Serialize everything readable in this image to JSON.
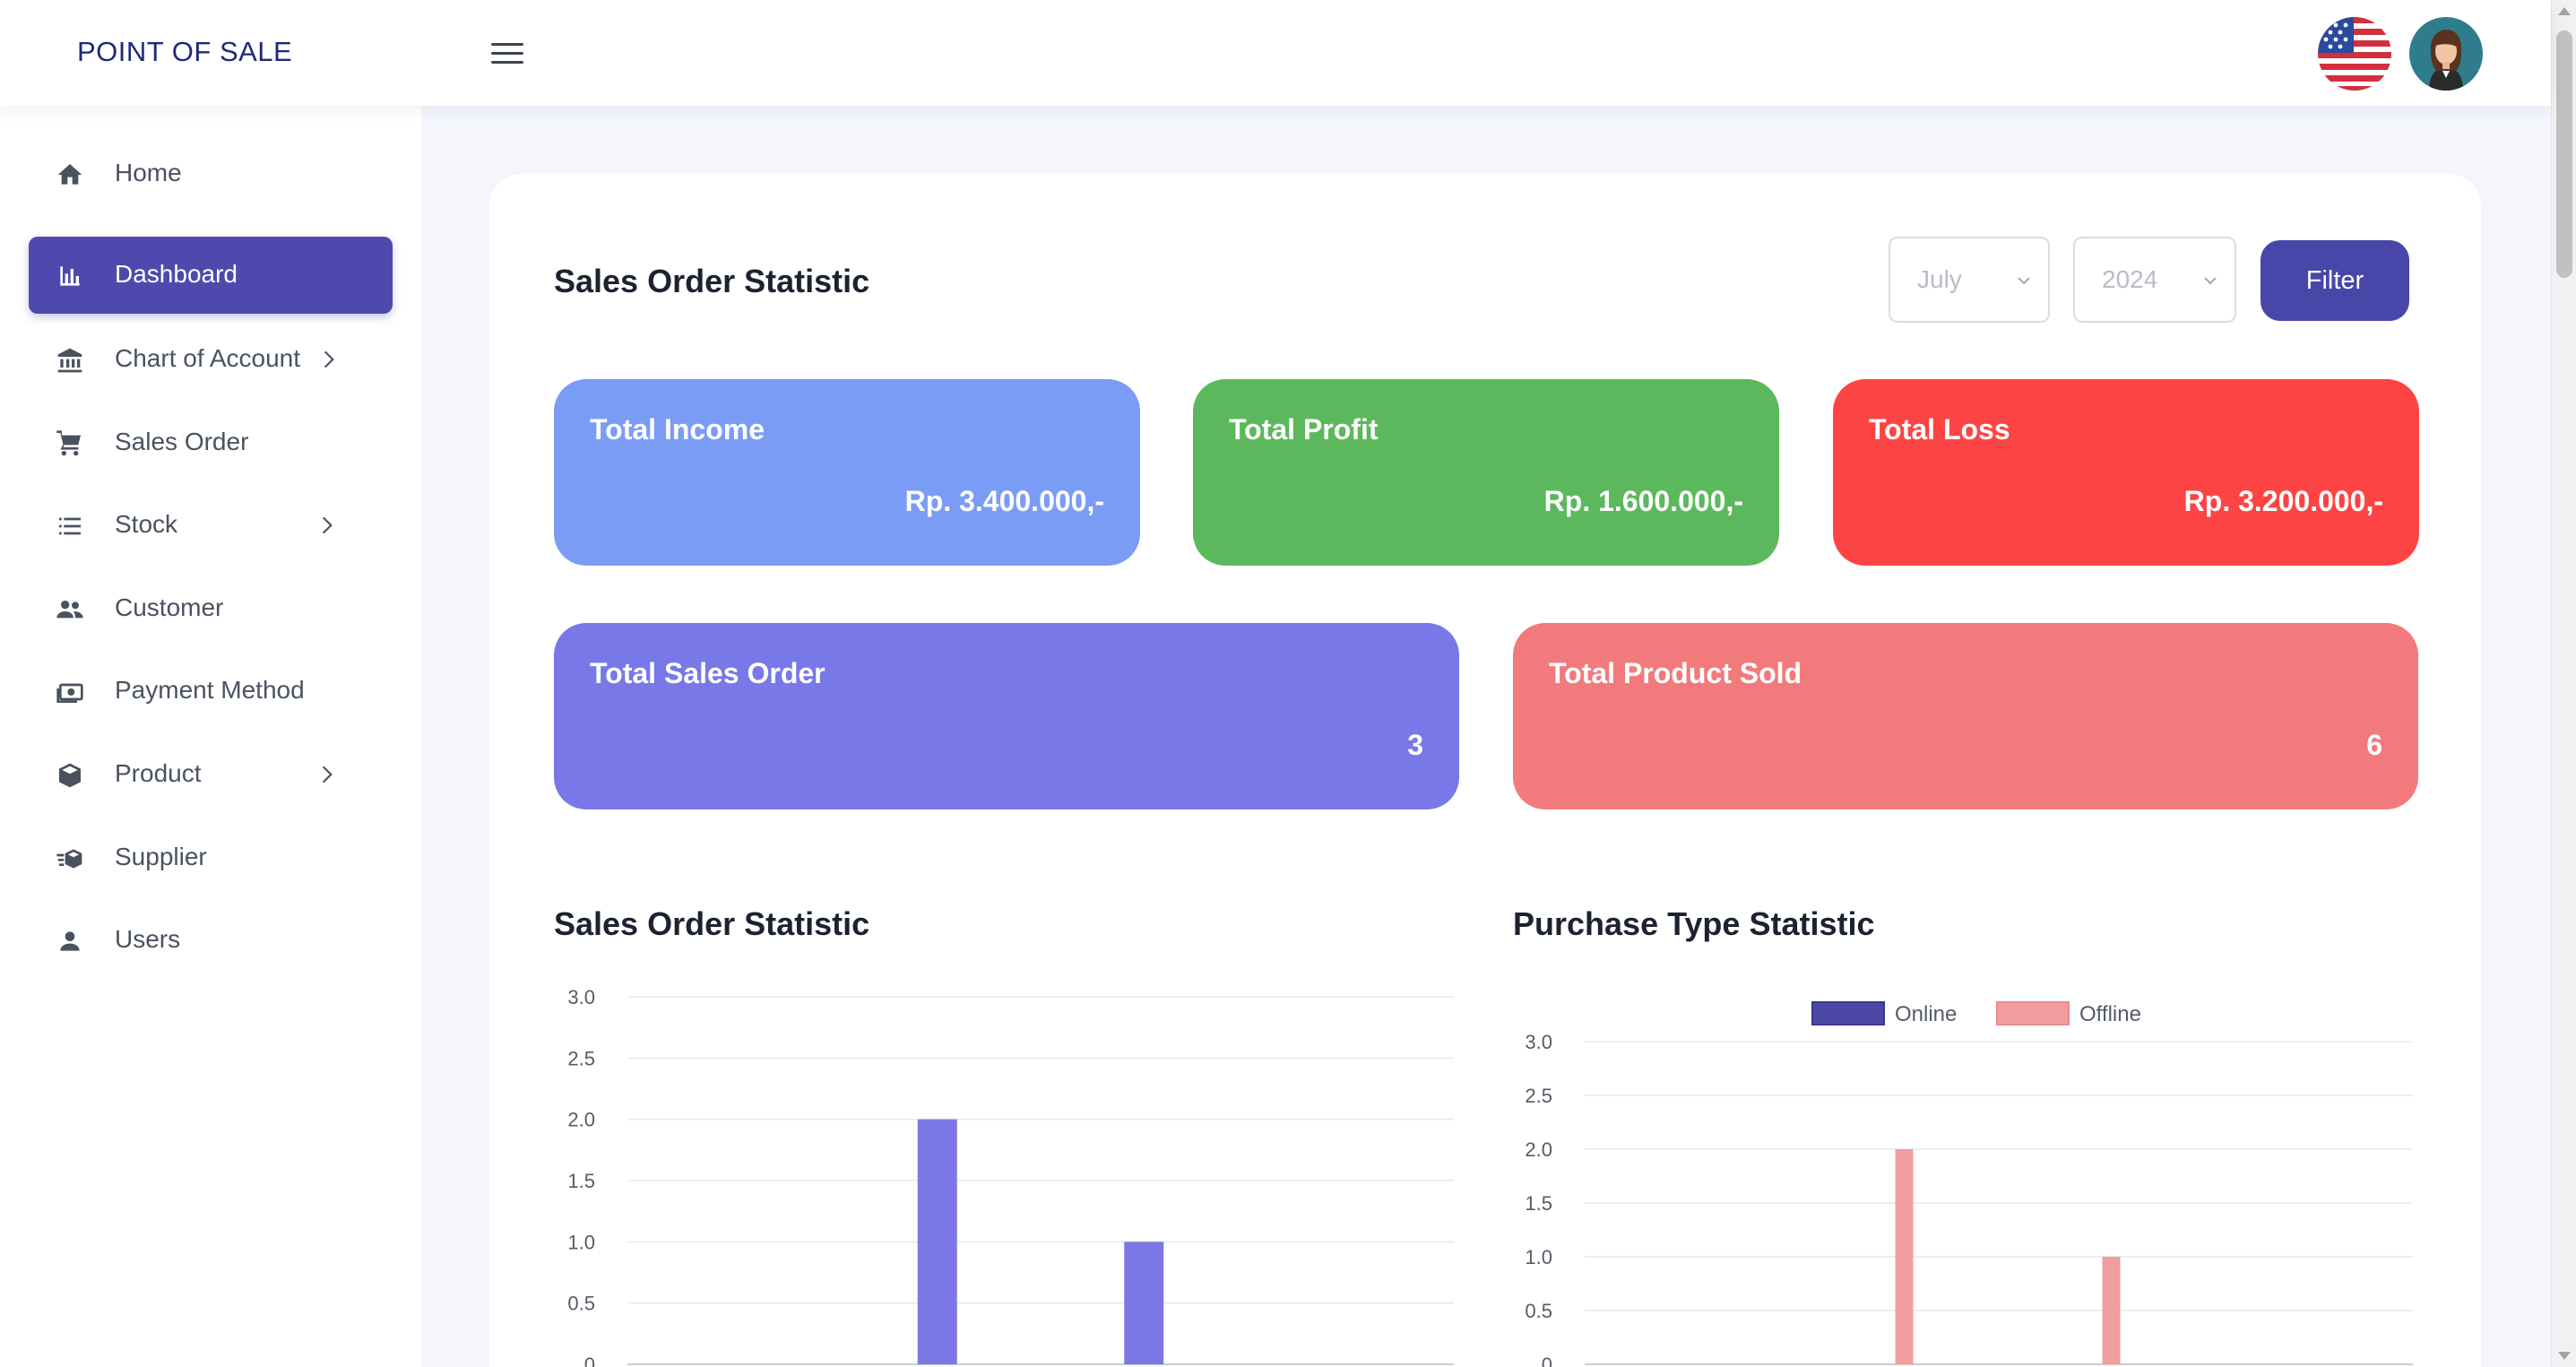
{
  "header": {
    "brand": "POINT OF SALE",
    "menu_icon": "hamburger-menu-icon",
    "language_icon": "us-flag-icon",
    "avatar_icon": "user-avatar-icon"
  },
  "sidebar": {
    "items": [
      {
        "label": "Home",
        "icon": "home-icon",
        "has_submenu": false,
        "active": false
      },
      {
        "label": "Dashboard",
        "icon": "bar-chart-icon",
        "has_submenu": false,
        "active": true
      },
      {
        "label": "Chart of Account",
        "icon": "bank-icon",
        "has_submenu": true,
        "active": false
      },
      {
        "label": "Sales Order",
        "icon": "cart-icon",
        "has_submenu": false,
        "active": false
      },
      {
        "label": "Stock",
        "icon": "list-icon",
        "has_submenu": true,
        "active": false
      },
      {
        "label": "Customer",
        "icon": "people-icon",
        "has_submenu": false,
        "active": false
      },
      {
        "label": "Payment Method",
        "icon": "payment-icon",
        "has_submenu": false,
        "active": false
      },
      {
        "label": "Product",
        "icon": "box-icon",
        "has_submenu": true,
        "active": false
      },
      {
        "label": "Supplier",
        "icon": "supplier-icon",
        "has_submenu": false,
        "active": false
      },
      {
        "label": "Users",
        "icon": "user-icon",
        "has_submenu": false,
        "active": false
      }
    ]
  },
  "main": {
    "title": "Sales Order Statistic",
    "filters": {
      "month": "July",
      "year": "2024",
      "button": "Filter"
    },
    "stats": [
      {
        "label": "Total Income",
        "value": "Rp. 3.400.000,-",
        "color": "#7b9cf5"
      },
      {
        "label": "Total Profit",
        "value": "Rp. 1.600.000,-",
        "color": "#5cb85c"
      },
      {
        "label": "Total Loss",
        "value": "Rp. 3.200.000,-",
        "color": "#fd4444"
      },
      {
        "label": "Total Sales Order",
        "value": "3",
        "color": "#7878e8"
      },
      {
        "label": "Total Product Sold",
        "value": "6",
        "color": "#f27a7c"
      }
    ],
    "colors": {
      "primary": "#4e4aad",
      "sales_bar": "#7b78e6",
      "online": "#4c48a8",
      "offline": "#f19ea0"
    }
  },
  "chart_data": [
    {
      "type": "bar",
      "title": "Sales Order Statistic",
      "ylim": [
        0,
        3
      ],
      "yticks": [
        "0",
        "0.5",
        "1.0",
        "1.5",
        "2.0",
        "2.5",
        "3.0"
      ],
      "categories": [
        "",
        "",
        "",
        ""
      ],
      "values": [
        0,
        2,
        1,
        0
      ],
      "legend": "none",
      "grid": true
    },
    {
      "type": "bar",
      "title": "Purchase Type Statistic",
      "ylim": [
        0,
        3
      ],
      "yticks": [
        "0",
        "0.5",
        "1.0",
        "1.5",
        "2.0",
        "2.5",
        "3.0"
      ],
      "categories": [
        "",
        "",
        "",
        ""
      ],
      "series": [
        {
          "name": "Online",
          "values": [
            0,
            0,
            0,
            0
          ]
        },
        {
          "name": "Offline",
          "values": [
            0,
            2,
            1,
            0
          ]
        }
      ],
      "legend": "top-center",
      "grid": true
    }
  ]
}
